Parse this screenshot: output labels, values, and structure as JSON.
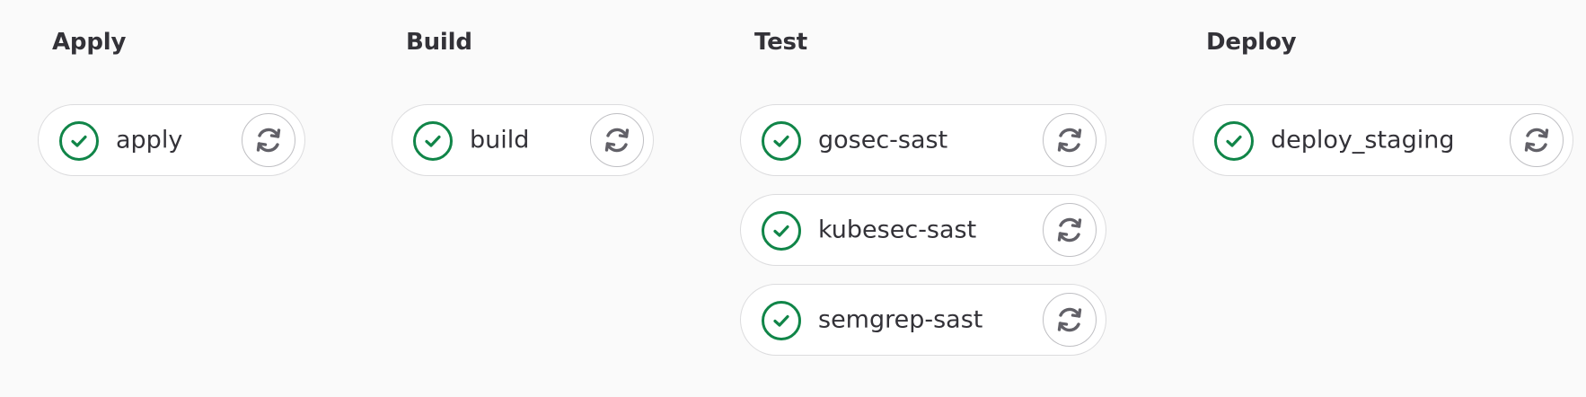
{
  "stages": [
    {
      "title": "Apply",
      "jobs": [
        {
          "name": "apply",
          "status": "success"
        }
      ]
    },
    {
      "title": "Build",
      "jobs": [
        {
          "name": "build",
          "status": "success"
        }
      ]
    },
    {
      "title": "Test",
      "jobs": [
        {
          "name": "gosec-sast",
          "status": "success"
        },
        {
          "name": "kubesec-sast",
          "status": "success"
        },
        {
          "name": "semgrep-sast",
          "status": "success"
        }
      ]
    },
    {
      "title": "Deploy",
      "jobs": [
        {
          "name": "deploy_staging",
          "status": "success"
        }
      ]
    }
  ],
  "icons": {
    "status": "check-circle-icon",
    "action": "retry-icon"
  },
  "colors": {
    "success": "#108548",
    "retry": "#626168",
    "background": "#fafafa"
  }
}
